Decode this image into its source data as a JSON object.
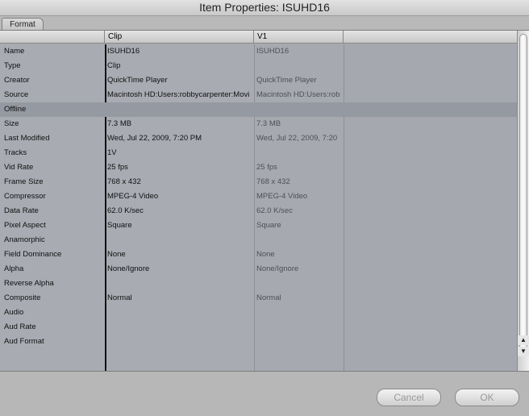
{
  "window": {
    "title": "Item Properties: ISUHD16"
  },
  "tabs": [
    {
      "label": "Format"
    }
  ],
  "columns": {
    "clip": "Clip",
    "v1": "V1"
  },
  "rows": [
    {
      "label": "Name",
      "clip": "ISUHD16",
      "v1": "ISUHD16"
    },
    {
      "label": "Type",
      "clip": "Clip",
      "v1": ""
    },
    {
      "label": "Creator",
      "clip": "QuickTime Player",
      "v1": "QuickTime Player"
    },
    {
      "label": "Source",
      "clip": "Macintosh HD:Users:robbycarpenter:Movi",
      "v1": "Macintosh HD:Users:rob"
    },
    {
      "label": "Offline",
      "clip": "",
      "v1": ""
    },
    {
      "label": "Size",
      "clip": "7.3 MB",
      "v1": "7.3 MB"
    },
    {
      "label": "Last Modified",
      "clip": "Wed, Jul 22, 2009, 7:20 PM",
      "v1": "Wed, Jul 22, 2009, 7:20"
    },
    {
      "label": "Tracks",
      "clip": "1V",
      "v1": ""
    },
    {
      "label": "Vid Rate",
      "clip": "25 fps",
      "v1": "25 fps"
    },
    {
      "label": "Frame Size",
      "clip": "768 x 432",
      "v1": "768 x 432"
    },
    {
      "label": "Compressor",
      "clip": "MPEG-4 Video",
      "v1": "MPEG-4 Video"
    },
    {
      "label": "Data Rate",
      "clip": "62.0 K/sec",
      "v1": "62.0 K/sec"
    },
    {
      "label": "Pixel Aspect",
      "clip": "Square",
      "v1": "Square"
    },
    {
      "label": "Anamorphic",
      "clip": "",
      "v1": ""
    },
    {
      "label": "Field Dominance",
      "clip": "None",
      "v1": "None"
    },
    {
      "label": "Alpha",
      "clip": "None/Ignore",
      "v1": "None/Ignore"
    },
    {
      "label": "Reverse Alpha",
      "clip": "",
      "v1": ""
    },
    {
      "label": "Composite",
      "clip": "Normal",
      "v1": "Normal"
    },
    {
      "label": "Audio",
      "clip": "",
      "v1": ""
    },
    {
      "label": "Aud Rate",
      "clip": "",
      "v1": ""
    },
    {
      "label": "Aud Format",
      "clip": "",
      "v1": ""
    }
  ],
  "buttons": {
    "cancel": "Cancel",
    "ok": "OK"
  },
  "colors": {
    "panel": "#a8abb2",
    "selected_row": "#9599a1",
    "window": "#b7b7b7"
  }
}
